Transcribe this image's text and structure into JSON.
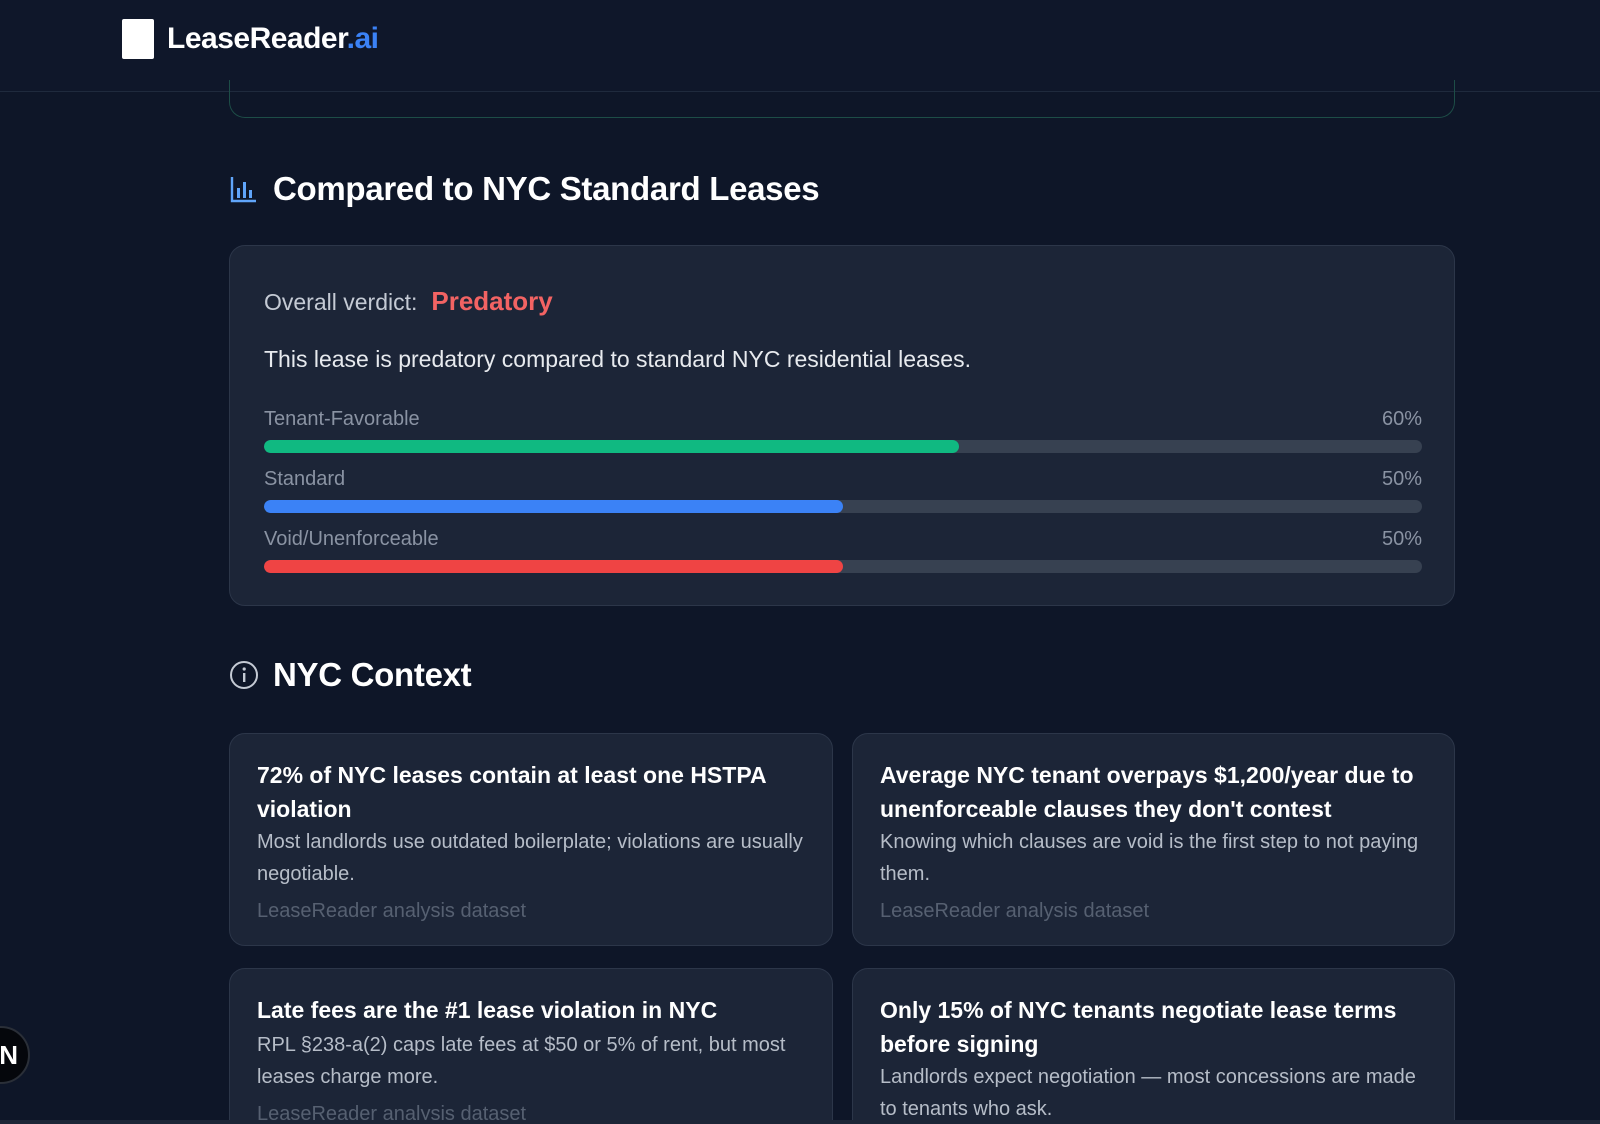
{
  "header": {
    "logo_text": "LeaseReader",
    "logo_accent": ".ai"
  },
  "comparison": {
    "title": "Compared to NYC Standard Leases",
    "verdict_label": "Overall verdict:",
    "verdict_value": "Predatory",
    "description": "This lease is predatory compared to standard NYC residential leases.",
    "bars": [
      {
        "label": "Tenant-Favorable",
        "percent_text": "60%",
        "percent": 60,
        "color": "#10b981"
      },
      {
        "label": "Standard",
        "percent_text": "50%",
        "percent": 50,
        "color": "#3b82f6"
      },
      {
        "label": "Void/Unenforceable",
        "percent_text": "50%",
        "percent": 50,
        "color": "#ef4444"
      }
    ]
  },
  "context": {
    "title": "NYC Context",
    "cards": [
      {
        "title": "72% of NYC leases contain at least one HSTPA violation",
        "body": "Most landlords use outdated boilerplate; violations are usually negotiable.",
        "source": "LeaseReader analysis dataset"
      },
      {
        "title": "Average NYC tenant overpays $1,200/year due to unenforceable clauses they don't contest",
        "body": "Knowing which clauses are void is the first step to not paying them.",
        "source": "LeaseReader analysis dataset"
      },
      {
        "title": "Late fees are the #1 lease violation in NYC",
        "body": "RPL §238-a(2) caps late fees at $50 or 5% of rent, but most leases charge more.",
        "source": "LeaseReader analysis dataset"
      },
      {
        "title": "Only 15% of NYC tenants negotiate lease terms before signing",
        "body": "Landlords expect negotiation — most concessions are made to tenants who ask.",
        "source": ""
      }
    ]
  },
  "fab": {
    "label": "N"
  },
  "colors": {
    "background": "#0e1628",
    "card": "#1c2537",
    "accent": "#3b82f6",
    "danger": "#f26363"
  }
}
